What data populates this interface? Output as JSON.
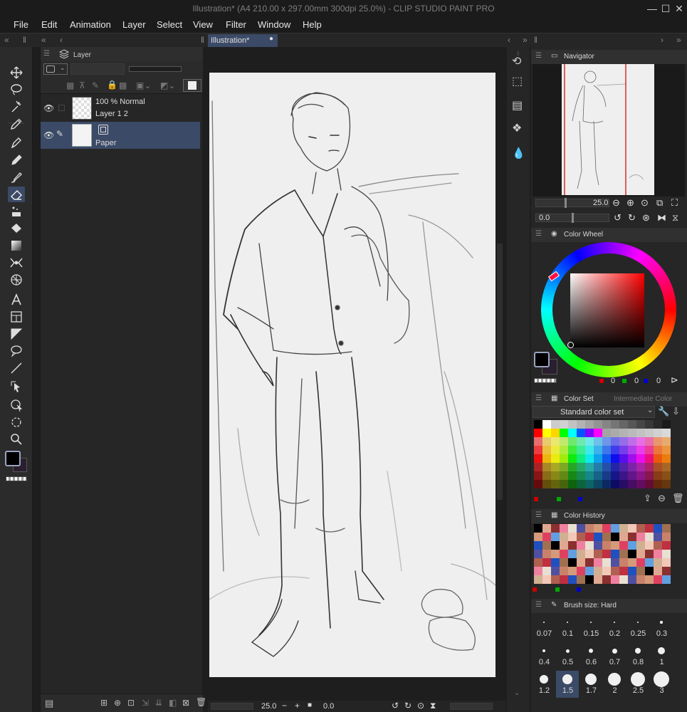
{
  "titlebar": {
    "title": "Illustration* (A4 210.00 x 297.00mm 300dpi 25.0%) - CLIP STUDIO PAINT PRO",
    "minimize": "—",
    "maximize": "☐",
    "close": "✕"
  },
  "menu": [
    "File",
    "Edit",
    "Animation",
    "Layer",
    "Select",
    "View",
    "Filter",
    "Window",
    "Help"
  ],
  "layers": {
    "title": "Layer",
    "items": [
      {
        "mode": "100 % Normal",
        "name": "Layer 1 2"
      },
      {
        "mode": "",
        "name": "Paper"
      }
    ]
  },
  "document": {
    "tab": "Illustration*",
    "zoom": "25.0",
    "rotation": "0.0"
  },
  "navigator": {
    "title": "Navigator",
    "zoom": "25.0",
    "rotation": "0.0"
  },
  "colorwheel": {
    "title": "Color Wheel",
    "r": "0",
    "g": "0",
    "b": "0",
    "hue_color": "#ff0000"
  },
  "colorset": {
    "title": "Color Set",
    "tab2": "Intermediate Color",
    "set_name": "Standard color set"
  },
  "colorhistory": {
    "title": "Color History"
  },
  "brushsize": {
    "title": "Brush size: Hard",
    "sizes": [
      "0.07",
      "0.1",
      "0.15",
      "0.2",
      "0.25",
      "0.3",
      "0.4",
      "0.5",
      "0.6",
      "0.7",
      "0.8",
      "1",
      "1.2",
      "1.5",
      "1.7",
      "2",
      "2.5",
      "3"
    ],
    "selected": "1.5"
  },
  "colors": {
    "accent": "#3b4a66",
    "main_color": "#000000",
    "sub_color": "#2a1f2e"
  }
}
